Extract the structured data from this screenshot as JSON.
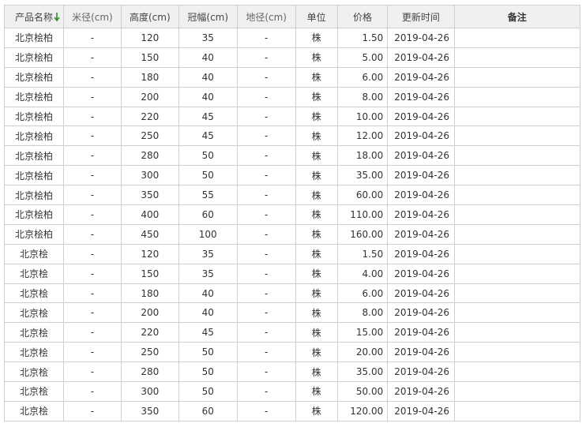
{
  "table": {
    "headers": [
      "产品名称",
      "米径(cm)",
      "高度(cm)",
      "冠幅(cm)",
      "地径(cm)",
      "单位",
      "价格",
      "更新时间",
      "备注"
    ],
    "sort_column": "产品名称",
    "sort_icon": "arrow-down-icon",
    "colors": {
      "sort_icon": "#2e8b2e",
      "header_bg": "#f0f0f0",
      "border": "#cfcfcf"
    },
    "rows": [
      [
        "北京桧柏",
        "-",
        "120",
        "35",
        "-",
        "株",
        "1.50",
        "2019-04-26",
        ""
      ],
      [
        "北京桧柏",
        "-",
        "150",
        "40",
        "-",
        "株",
        "5.00",
        "2019-04-26",
        ""
      ],
      [
        "北京桧柏",
        "-",
        "180",
        "40",
        "-",
        "株",
        "6.00",
        "2019-04-26",
        ""
      ],
      [
        "北京桧柏",
        "-",
        "200",
        "40",
        "-",
        "株",
        "8.00",
        "2019-04-26",
        ""
      ],
      [
        "北京桧柏",
        "-",
        "220",
        "45",
        "-",
        "株",
        "10.00",
        "2019-04-26",
        ""
      ],
      [
        "北京桧柏",
        "-",
        "250",
        "45",
        "-",
        "株",
        "12.00",
        "2019-04-26",
        ""
      ],
      [
        "北京桧柏",
        "-",
        "280",
        "50",
        "-",
        "株",
        "18.00",
        "2019-04-26",
        ""
      ],
      [
        "北京桧柏",
        "-",
        "300",
        "50",
        "-",
        "株",
        "35.00",
        "2019-04-26",
        ""
      ],
      [
        "北京桧柏",
        "-",
        "350",
        "55",
        "-",
        "株",
        "60.00",
        "2019-04-26",
        ""
      ],
      [
        "北京桧柏",
        "-",
        "400",
        "60",
        "-",
        "株",
        "110.00",
        "2019-04-26",
        ""
      ],
      [
        "北京桧柏",
        "-",
        "450",
        "100",
        "-",
        "株",
        "160.00",
        "2019-04-26",
        ""
      ],
      [
        "北京桧",
        "-",
        "120",
        "35",
        "-",
        "株",
        "1.50",
        "2019-04-26",
        ""
      ],
      [
        "北京桧",
        "-",
        "150",
        "35",
        "-",
        "株",
        "4.00",
        "2019-04-26",
        ""
      ],
      [
        "北京桧",
        "-",
        "180",
        "40",
        "-",
        "株",
        "6.00",
        "2019-04-26",
        ""
      ],
      [
        "北京桧",
        "-",
        "200",
        "40",
        "-",
        "株",
        "8.00",
        "2019-04-26",
        ""
      ],
      [
        "北京桧",
        "-",
        "220",
        "45",
        "-",
        "株",
        "15.00",
        "2019-04-26",
        ""
      ],
      [
        "北京桧",
        "-",
        "250",
        "50",
        "-",
        "株",
        "20.00",
        "2019-04-26",
        ""
      ],
      [
        "北京桧",
        "-",
        "280",
        "50",
        "-",
        "株",
        "35.00",
        "2019-04-26",
        ""
      ],
      [
        "北京桧",
        "-",
        "300",
        "50",
        "-",
        "株",
        "50.00",
        "2019-04-26",
        ""
      ],
      [
        "北京桧",
        "-",
        "350",
        "60",
        "-",
        "株",
        "120.00",
        "2019-04-26",
        ""
      ]
    ]
  }
}
